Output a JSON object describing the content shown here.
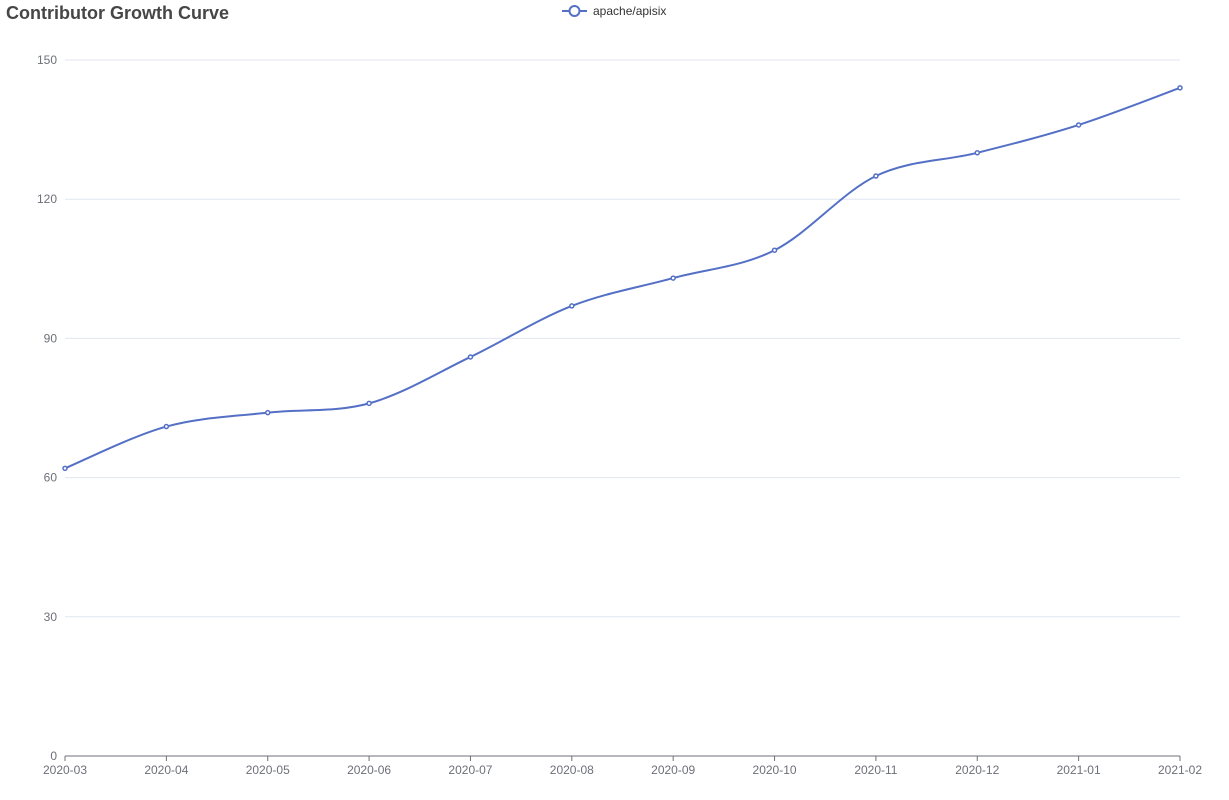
{
  "chart_data": {
    "type": "line",
    "title": "Contributor Growth Curve",
    "xlabel": "",
    "ylabel": "",
    "x": [
      "2020-03",
      "2020-04",
      "2020-05",
      "2020-06",
      "2020-07",
      "2020-08",
      "2020-09",
      "2020-10",
      "2020-11",
      "2020-12",
      "2021-01",
      "2021-02"
    ],
    "series": [
      {
        "name": "apache/apisix",
        "values": [
          62,
          71,
          74,
          76,
          86,
          97,
          103,
          109,
          125,
          130,
          136,
          144
        ],
        "color": "#5470c6"
      }
    ],
    "ylim": [
      0,
      150
    ],
    "y_ticks": [
      0,
      30,
      60,
      90,
      120,
      150
    ],
    "smooth": true,
    "grid": "horizontal",
    "legend_position": "top-center"
  },
  "colors": {
    "series": "#5470c6",
    "grid": "#e0e6f1",
    "axis": "#6e7079",
    "title": "#464646"
  }
}
